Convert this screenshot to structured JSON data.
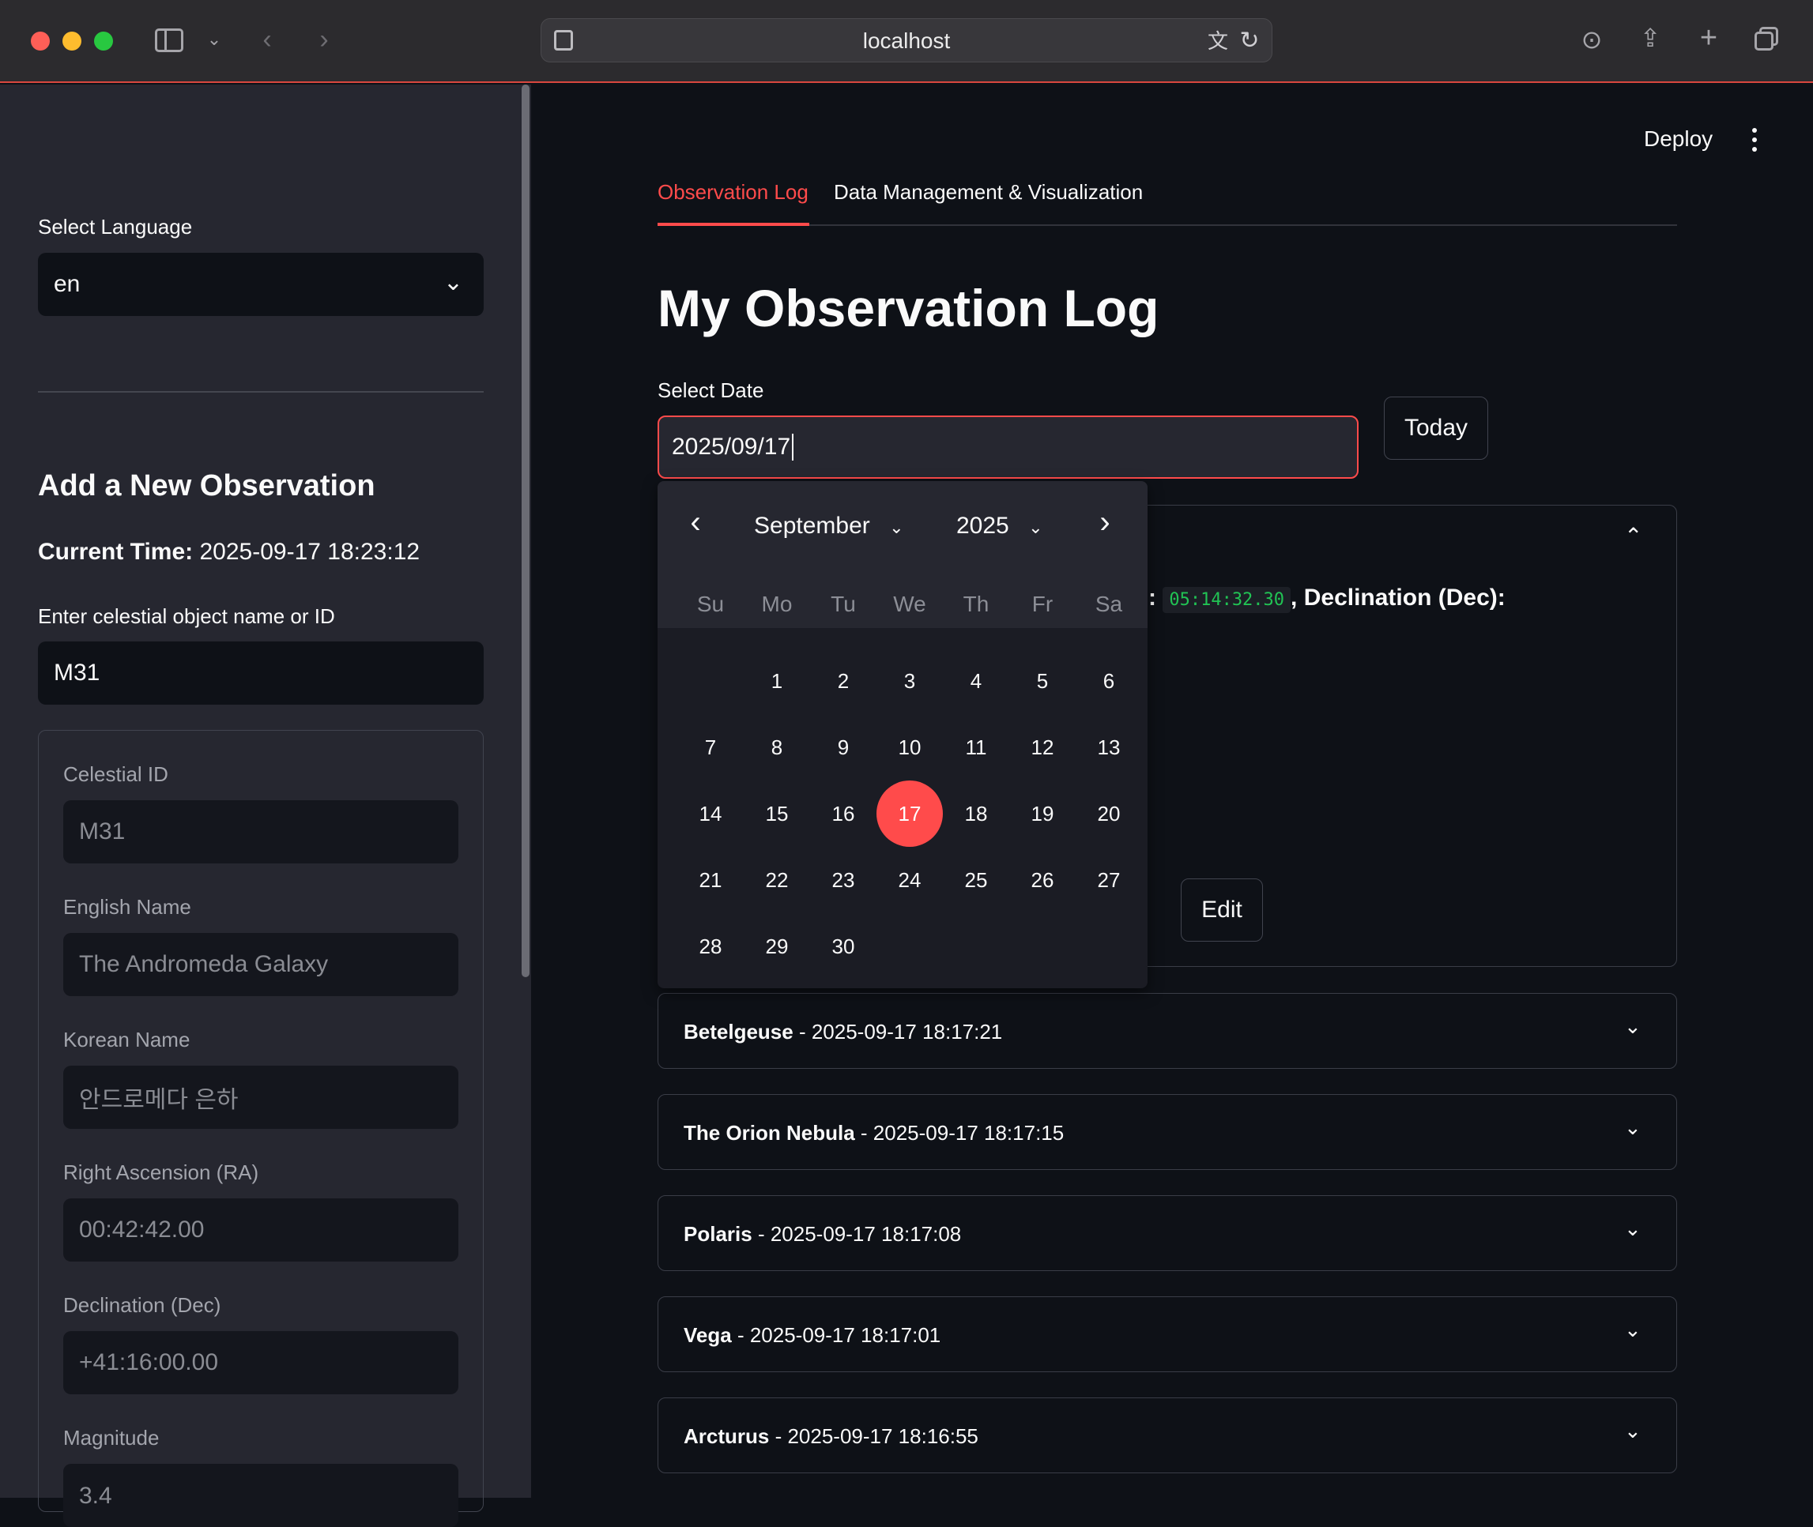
{
  "browser": {
    "url": "localhost"
  },
  "sidebar": {
    "language_label": "Select Language",
    "language_value": "en",
    "add_heading": "Add a New Observation",
    "current_time_label": "Current Time:",
    "current_time_value": "2025-09-17 18:23:12",
    "object_label": "Enter celestial object name or ID",
    "object_value": "M31",
    "details": {
      "id_label": "Celestial ID",
      "id_value": "M31",
      "english_label": "English Name",
      "english_value": "The Andromeda Galaxy",
      "korean_label": "Korean Name",
      "korean_value": "안드로메다 은하",
      "ra_label": "Right Ascension (RA)",
      "ra_value": "00:42:42.00",
      "dec_label": "Declination (Dec)",
      "dec_value": "+41:16:00.00",
      "mag_label": "Magnitude",
      "mag_value": "3.4"
    }
  },
  "header": {
    "deploy_label": "Deploy"
  },
  "tabs": [
    {
      "label": "Observation Log",
      "active": true
    },
    {
      "label": "Data Management & Visualization",
      "active": false
    }
  ],
  "main": {
    "title": "My Observation Log",
    "date_label": "Select Date",
    "date_value": "2025/09/17",
    "today_label": "Today",
    "expanded_entry": {
      "ra_code": "05:14:32.30",
      "dec_label": ", Declination (Dec):",
      "colon": ":",
      "edit_label": "Edit"
    },
    "entries": [
      {
        "name": "Betelgeuse",
        "time": " - 2025-09-17 18:17:21"
      },
      {
        "name": "The Orion Nebula",
        "time": " - 2025-09-17 18:17:15"
      },
      {
        "name": "Polaris",
        "time": " - 2025-09-17 18:17:08"
      },
      {
        "name": "Vega",
        "time": " - 2025-09-17 18:17:01"
      },
      {
        "name": "Arcturus",
        "time": " - 2025-09-17 18:16:55"
      }
    ]
  },
  "datepicker": {
    "month": "September",
    "year": "2025",
    "weekdays": [
      "Su",
      "Mo",
      "Tu",
      "We",
      "Th",
      "Fr",
      "Sa"
    ],
    "days": [
      "1",
      "2",
      "3",
      "4",
      "5",
      "6",
      "7",
      "8",
      "9",
      "10",
      "11",
      "12",
      "13",
      "14",
      "15",
      "16",
      "17",
      "18",
      "19",
      "20",
      "21",
      "22",
      "23",
      "24",
      "25",
      "26",
      "27",
      "28",
      "29",
      "30"
    ],
    "first_weekday_index": 1,
    "selected_day": "17"
  },
  "colors": {
    "accent": "#ff4b4b",
    "background": "#0e1117",
    "sidebar": "#262730",
    "code_green": "#21c354"
  }
}
